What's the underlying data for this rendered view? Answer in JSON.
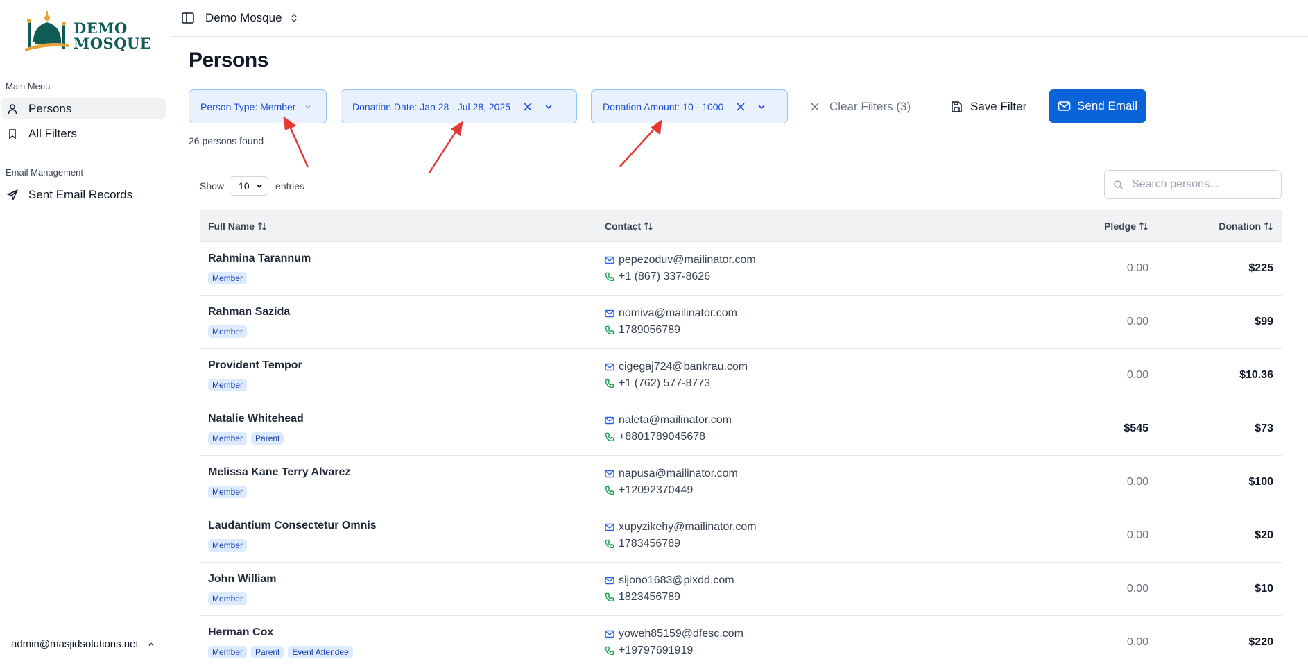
{
  "sidebar": {
    "logo_line1": "DEMO",
    "logo_line2": "MOSQUE",
    "main_menu_label": "Main Menu",
    "main_items": [
      {
        "label": "Persons",
        "icon": "user-icon",
        "active": true
      },
      {
        "label": "All Filters",
        "icon": "bookmark-icon",
        "active": false
      }
    ],
    "email_label": "Email Management",
    "email_items": [
      {
        "label": "Sent Email Records",
        "icon": "send-icon"
      }
    ],
    "footer_user": "admin@masjidsolutions.net"
  },
  "topbar": {
    "org_name": "Demo Mosque"
  },
  "page": {
    "title": "Persons",
    "found_text": "26 persons found"
  },
  "filters": [
    {
      "label": "Person Type: Member"
    },
    {
      "label": "Donation Date: Jan 28 - Jul 28, 2025"
    },
    {
      "label": "Donation Amount: 10 - 1000"
    }
  ],
  "actions": {
    "clear_label": "Clear Filters (3)",
    "save_label": "Save Filter",
    "send_label": "Send Email"
  },
  "table_controls": {
    "show_label": "Show",
    "entries_value": "10",
    "entries_label": "entries",
    "search_placeholder": "Search persons..."
  },
  "columns": {
    "name": "Full Name",
    "contact": "Contact",
    "pledge": "Pledge",
    "donation": "Donation"
  },
  "rows": [
    {
      "name": "Rahmina Tarannum",
      "tags": [
        "Member"
      ],
      "email": "pepezoduv@mailinator.com",
      "phone": "+1 (867) 337-8626",
      "pledge": "0.00",
      "donation": "$225"
    },
    {
      "name": "Rahman Sazida",
      "tags": [
        "Member"
      ],
      "email": "nomiva@mailinator.com",
      "phone": "1789056789",
      "pledge": "0.00",
      "donation": "$99"
    },
    {
      "name": "Provident Tempor",
      "tags": [
        "Member"
      ],
      "email": "cigegaj724@bankrau.com",
      "phone": "+1 (762) 577-8773",
      "pledge": "0.00",
      "donation": "$10.36"
    },
    {
      "name": "Natalie Whitehead",
      "tags": [
        "Member",
        "Parent"
      ],
      "email": "naleta@mailinator.com",
      "phone": "+8801789045678",
      "pledge": "$545",
      "donation": "$73"
    },
    {
      "name": "Melissa Kane Terry Alvarez",
      "tags": [
        "Member"
      ],
      "email": "napusa@mailinator.com",
      "phone": "+12092370449",
      "pledge": "0.00",
      "donation": "$100"
    },
    {
      "name": "Laudantium Consectetur Omnis",
      "tags": [
        "Member"
      ],
      "email": "xupyzikehy@mailinator.com",
      "phone": "1783456789",
      "pledge": "0.00",
      "donation": "$20"
    },
    {
      "name": "John William",
      "tags": [
        "Member"
      ],
      "email": "sijono1683@pixdd.com",
      "phone": "1823456789",
      "pledge": "0.00",
      "donation": "$10"
    },
    {
      "name": "Herman Cox",
      "tags": [
        "Member",
        "Parent",
        "Event Attendee"
      ],
      "email": "yoweh85159@dfesc.com",
      "phone": "+19797691919",
      "pledge": "0.00",
      "donation": "$220"
    }
  ],
  "colors": {
    "primary": "#0b63d9",
    "chip_bg": "#e8f1fc",
    "chip_border": "#93c5fd",
    "tag_bg": "#dbeafe",
    "phone_icon": "#16a34a",
    "email_icon": "#2563eb",
    "annotation_arrow": "#e53935"
  }
}
